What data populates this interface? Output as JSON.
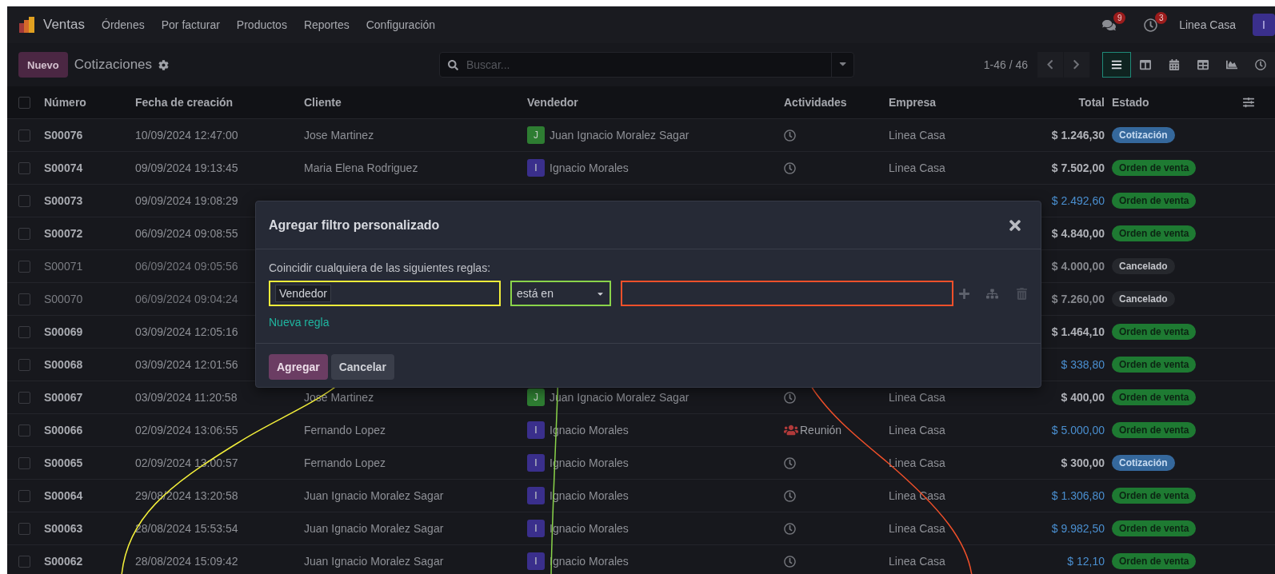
{
  "navbar": {
    "app": "Ventas",
    "menus": [
      "Órdenes",
      "Por facturar",
      "Productos",
      "Reportes",
      "Configuración"
    ],
    "messages_badge": "9",
    "activities_badge": "3",
    "company": "Linea Casa",
    "avatar": "I"
  },
  "control_panel": {
    "new_button": "Nuevo",
    "title": "Cotizaciones",
    "search": {
      "placeholder": "Buscar..."
    },
    "pager": "1-46 / 46",
    "views": [
      {
        "kind": "list",
        "selected": true
      },
      {
        "kind": "kanban",
        "selected": false
      },
      {
        "kind": "calendar",
        "selected": false
      },
      {
        "kind": "pivot",
        "selected": false
      },
      {
        "kind": "graph",
        "selected": false
      },
      {
        "kind": "activity",
        "selected": false
      }
    ]
  },
  "table": {
    "select_all_checked": false,
    "columns": [
      "Número",
      "Fecha de creación",
      "Cliente",
      "Vendedor",
      "Actividades",
      "Empresa",
      "Total",
      "Estado"
    ],
    "rows": [
      {
        "number": "S00076",
        "date": "10/09/2024 12:47:00",
        "client": "Jose Martinez",
        "salesperson": {
          "initial": "J",
          "name": "Juan Ignacio Moralez Sagar",
          "color": "#2e7d32"
        },
        "activity": {
          "kind": "clock"
        },
        "company": "Linea Casa",
        "total": "$ 1.246,30",
        "total_highlighted": false,
        "status": {
          "label": "Cotización",
          "kind": "quotation"
        },
        "checked": false
      },
      {
        "number": "S00074",
        "date": "09/09/2024 19:13:45",
        "client": "Maria Elena Rodriguez",
        "salesperson": {
          "initial": "I",
          "name": "Ignacio Morales",
          "color": "#3a2f8c"
        },
        "activity": {
          "kind": "clock"
        },
        "company": "Linea Casa",
        "total": "$ 7.502,00",
        "total_highlighted": false,
        "status": {
          "label": "Orden de venta",
          "kind": "sale"
        },
        "checked": false
      },
      {
        "number": "S00073",
        "date": "09/09/2024 19:08:29",
        "total": "$ 2.492,60",
        "total_highlighted": true,
        "status": {
          "label": "Orden de venta",
          "kind": "sale"
        },
        "checked": false
      },
      {
        "number": "S00072",
        "date": "06/09/2024 09:08:55",
        "total": "$ 4.840,00",
        "total_highlighted": false,
        "status": {
          "label": "Orden de venta",
          "kind": "sale"
        },
        "checked": false
      },
      {
        "number": "S00071",
        "date": "06/09/2024 09:05:56",
        "total": "$ 4.000,00",
        "total_highlighted": false,
        "status": {
          "label": "Cancelado",
          "kind": "cancelled"
        },
        "checked": false
      },
      {
        "number": "S00070",
        "date": "06/09/2024 09:04:24",
        "total": "$ 7.260,00",
        "total_highlighted": false,
        "status": {
          "label": "Cancelado",
          "kind": "cancelled"
        },
        "checked": false
      },
      {
        "number": "S00069",
        "date": "03/09/2024 12:05:16",
        "total": "$ 1.464,10",
        "total_highlighted": false,
        "status": {
          "label": "Orden de venta",
          "kind": "sale"
        },
        "checked": false
      },
      {
        "number": "S00068",
        "date": "03/09/2024 12:01:56",
        "total": "$ 338,80",
        "total_highlighted": true,
        "status": {
          "label": "Orden de venta",
          "kind": "sale"
        },
        "checked": false
      },
      {
        "number": "S00067",
        "date": "03/09/2024 11:20:58",
        "client": "Jose Martinez",
        "salesperson": {
          "initial": "J",
          "name": "Juan Ignacio Moralez Sagar",
          "color": "#2e7d32"
        },
        "activity": {
          "kind": "clock"
        },
        "company": "Linea Casa",
        "total": "$ 400,00",
        "total_highlighted": false,
        "status": {
          "label": "Orden de venta",
          "kind": "sale"
        },
        "checked": false
      },
      {
        "number": "S00066",
        "date": "02/09/2024 13:06:55",
        "client": "Fernando Lopez",
        "salesperson": {
          "initial": "I",
          "name": "Ignacio Morales",
          "color": "#3a2f8c"
        },
        "activity": {
          "kind": "meeting",
          "label": "Reunión"
        },
        "company": "Linea Casa",
        "total": "$ 5.000,00",
        "total_highlighted": true,
        "status": {
          "label": "Orden de venta",
          "kind": "sale"
        },
        "checked": false
      },
      {
        "number": "S00065",
        "date": "02/09/2024 13:00:57",
        "client": "Fernando Lopez",
        "salesperson": {
          "initial": "I",
          "name": "Ignacio Morales",
          "color": "#3a2f8c"
        },
        "activity": {
          "kind": "clock"
        },
        "company": "Linea Casa",
        "total": "$ 300,00",
        "total_highlighted": false,
        "status": {
          "label": "Cotización",
          "kind": "quotation"
        },
        "checked": false
      },
      {
        "number": "S00064",
        "date": "29/08/2024 13:20:58",
        "client": "Juan Ignacio Moralez Sagar",
        "salesperson": {
          "initial": "I",
          "name": "Ignacio Morales",
          "color": "#3a2f8c"
        },
        "activity": {
          "kind": "clock"
        },
        "company": "Linea Casa",
        "total": "$ 1.306,80",
        "total_highlighted": true,
        "status": {
          "label": "Orden de venta",
          "kind": "sale"
        },
        "checked": false
      },
      {
        "number": "S00063",
        "date": "28/08/2024 15:53:54",
        "client": "Juan Ignacio Moralez Sagar",
        "salesperson": {
          "initial": "I",
          "name": "Ignacio Morales",
          "color": "#3a2f8c"
        },
        "activity": {
          "kind": "clock"
        },
        "company": "Linea Casa",
        "total": "$ 9.982,50",
        "total_highlighted": true,
        "status": {
          "label": "Orden de venta",
          "kind": "sale"
        },
        "checked": false
      },
      {
        "number": "S00062",
        "date": "28/08/2024 15:09:42",
        "client": "Juan Ignacio Moralez Sagar",
        "salesperson": {
          "initial": "I",
          "name": "Ignacio Morales",
          "color": "#3a2f8c"
        },
        "activity": {
          "kind": "clock"
        },
        "company": "Linea Casa",
        "total": "$ 12,10",
        "total_highlighted": true,
        "status": {
          "label": "Orden de venta",
          "kind": "sale"
        },
        "checked": false
      }
    ]
  },
  "dialog": {
    "title": "Agregar filtro personalizado",
    "intro": "Coincidir cualquiera de las siguientes reglas:",
    "rule": {
      "field": {
        "tag": "Vendedor",
        "color": "#f2ee3a"
      },
      "operator": {
        "value": "está en",
        "color": "#8ad44a"
      },
      "value": {
        "color": "#f0502a"
      }
    },
    "new_rule": "Nueva regla",
    "buttons": [
      {
        "label": "Agregar",
        "kind": "primary"
      },
      {
        "label": "Cancelar",
        "kind": "secondary"
      }
    ]
  }
}
